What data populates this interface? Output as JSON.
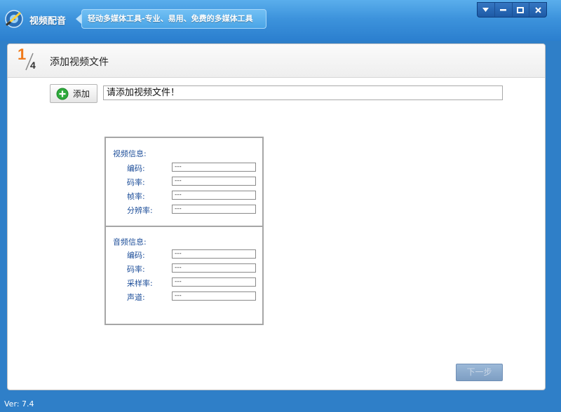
{
  "app": {
    "title": "视频配音",
    "slogan": "轻动多媒体工具-专业、易用、免费的多媒体工具",
    "version": "Ver: 7.4"
  },
  "window_controls": {
    "icons": [
      "dropdown-icon",
      "minimize-icon",
      "maximize-icon",
      "close-icon"
    ]
  },
  "step": {
    "current": "1",
    "total": "4",
    "title": "添加视频文件"
  },
  "add_button": {
    "label": "添加"
  },
  "file_input": {
    "value": "请添加视频文件！"
  },
  "video_info": {
    "title": "视频信息:",
    "fields": [
      {
        "label": "编码:",
        "value": "---"
      },
      {
        "label": "码率:",
        "value": "---"
      },
      {
        "label": "帧率:",
        "value": "---"
      },
      {
        "label": "分辨率:",
        "value": "---"
      }
    ]
  },
  "audio_info": {
    "title": "音频信息:",
    "fields": [
      {
        "label": "编码:",
        "value": "---"
      },
      {
        "label": "码率:",
        "value": "---"
      },
      {
        "label": "采样率:",
        "value": "---"
      },
      {
        "label": "声道:",
        "value": "---"
      }
    ]
  },
  "next_button": {
    "label": "下一步"
  },
  "colors": {
    "titlebar": "#3d93dc",
    "step_accent": "#f07a1a",
    "info_text": "#1e4f9a",
    "add_icon": "#2eaa3c"
  }
}
